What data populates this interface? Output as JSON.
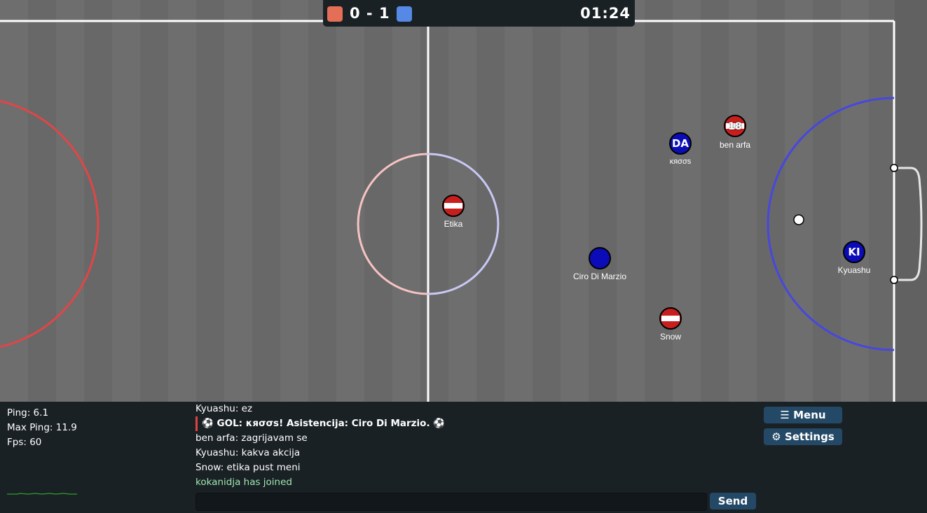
{
  "scoreboard": {
    "red_color": "#e56e56",
    "blue_color": "#5689e5",
    "score": "0 - 1",
    "time": "01:24"
  },
  "players": [
    {
      "name": "Etika",
      "team": "red",
      "avatar": "",
      "color": "#c71e1e"
    },
    {
      "name": "Ciro Di Marzio",
      "team": "blue",
      "avatar": "",
      "color": "#0b0cb7"
    },
    {
      "name": "Snow",
      "team": "red",
      "avatar": "",
      "color": "#c71e1e"
    },
    {
      "name": "κяσσѕ",
      "team": "blue",
      "avatar": "DA",
      "color": "#0b0cb7"
    },
    {
      "name": "ben arfa",
      "team": "red",
      "avatar": "18",
      "color": "#c71e1e"
    },
    {
      "name": "Kyuashu",
      "team": "blue",
      "avatar": "KI",
      "color": "#0b0cb7"
    }
  ],
  "stats": {
    "ping": "Ping: 6.1",
    "max_ping": "Max Ping: 11.9",
    "fps": "Fps: 60"
  },
  "chat": {
    "messages": [
      "Kyuashu: ez",
      "⚽ GOL:  κяσσѕ! Asistencija:  Ciro Di Marzio. ⚽",
      "ben arfa: zagrijavam se",
      "Kyuashu: kakva akcija",
      "Snow: etika pust meni",
      "kokanidja has joined"
    ],
    "input_value": "",
    "send_label": "Send"
  },
  "menu": {
    "menu_label": "Menu",
    "settings_label": "Settings"
  }
}
